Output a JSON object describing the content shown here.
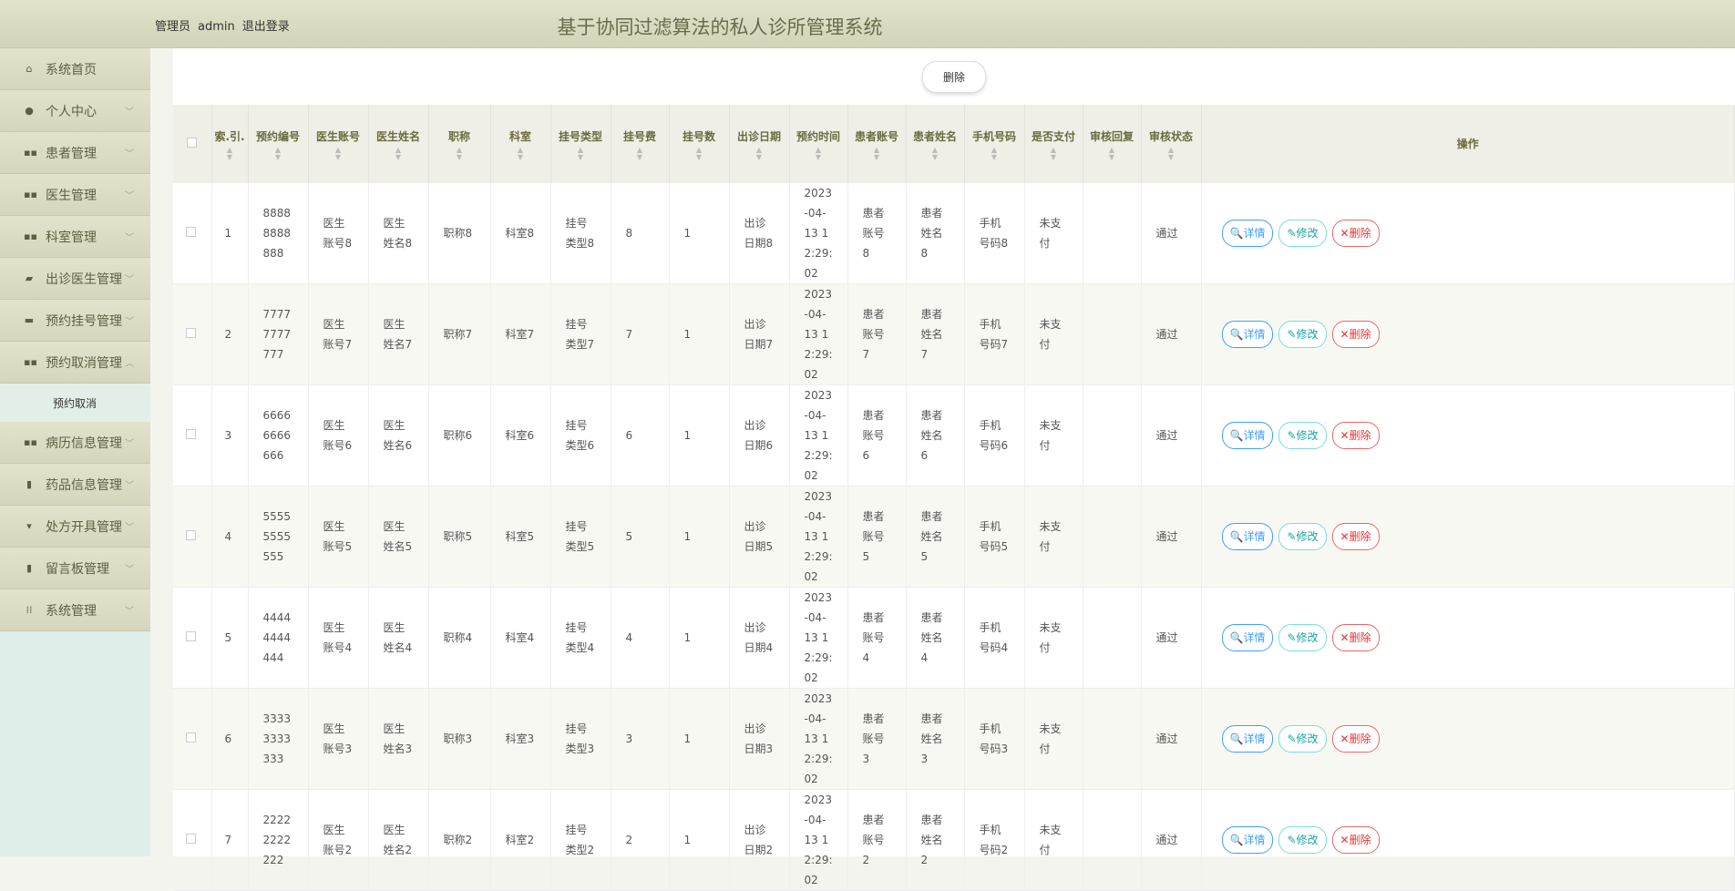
{
  "header": {
    "role": "管理员",
    "user": "admin",
    "logout": "退出登录",
    "title": "基于协同过滤算法的私人诊所管理系统"
  },
  "sidebar": {
    "items": [
      {
        "label": "系统首页",
        "icon": "home-icon"
      },
      {
        "label": "个人中心",
        "icon": "user-icon"
      },
      {
        "label": "患者管理",
        "icon": "grid-icon"
      },
      {
        "label": "医生管理",
        "icon": "grid-icon"
      },
      {
        "label": "科室管理",
        "icon": "grid-icon"
      },
      {
        "label": "出诊医生管理",
        "icon": "briefcase-icon"
      },
      {
        "label": "预约挂号管理",
        "icon": "monitor-icon"
      },
      {
        "label": "预约取消管理",
        "icon": "grid-icon",
        "sub": "预约取消"
      },
      {
        "label": "病历信息管理",
        "icon": "grid-icon"
      },
      {
        "label": "药品信息管理",
        "icon": "clipboard-icon"
      },
      {
        "label": "处方开具管理",
        "icon": "stamp-icon"
      },
      {
        "label": "留言板管理",
        "icon": "clipboard-x-icon"
      },
      {
        "label": "系统管理",
        "icon": "apps-icon"
      }
    ]
  },
  "toolbar": {
    "delete": "删除"
  },
  "table": {
    "headers": [
      "索.引.",
      "预约编号",
      "医生账号",
      "医生姓名",
      "职称",
      "科室",
      "挂号类型",
      "挂号费",
      "挂号数",
      "出诊日期",
      "预约时间",
      "患者账号",
      "患者姓名",
      "手机号码",
      "是否支付",
      "审核回复",
      "审核状态",
      "操作"
    ],
    "actions": {
      "detail": "详情",
      "edit": "修改",
      "delete": "删除"
    },
    "rows": [
      [
        "1",
        "88888888888",
        "医生账号8",
        "医生姓名8",
        "职称8",
        "科室8",
        "挂号类型8",
        "8",
        "1",
        "出诊日期8",
        "2023-04-13 12:29:02",
        "患者账号8",
        "患者姓名8",
        "手机号码8",
        "未支付",
        "",
        "通过"
      ],
      [
        "2",
        "77777777777",
        "医生账号7",
        "医生姓名7",
        "职称7",
        "科室7",
        "挂号类型7",
        "7",
        "1",
        "出诊日期7",
        "2023-04-13 12:29:02",
        "患者账号7",
        "患者姓名7",
        "手机号码7",
        "未支付",
        "",
        "通过"
      ],
      [
        "3",
        "66666666666",
        "医生账号6",
        "医生姓名6",
        "职称6",
        "科室6",
        "挂号类型6",
        "6",
        "1",
        "出诊日期6",
        "2023-04-13 12:29:02",
        "患者账号6",
        "患者姓名6",
        "手机号码6",
        "未支付",
        "",
        "通过"
      ],
      [
        "4",
        "55555555555",
        "医生账号5",
        "医生姓名5",
        "职称5",
        "科室5",
        "挂号类型5",
        "5",
        "1",
        "出诊日期5",
        "2023-04-13 12:29:02",
        "患者账号5",
        "患者姓名5",
        "手机号码5",
        "未支付",
        "",
        "通过"
      ],
      [
        "5",
        "44444444444",
        "医生账号4",
        "医生姓名4",
        "职称4",
        "科室4",
        "挂号类型4",
        "4",
        "1",
        "出诊日期4",
        "2023-04-13 12:29:02",
        "患者账号4",
        "患者姓名4",
        "手机号码4",
        "未支付",
        "",
        "通过"
      ],
      [
        "6",
        "33333333333",
        "医生账号3",
        "医生姓名3",
        "职称3",
        "科室3",
        "挂号类型3",
        "3",
        "1",
        "出诊日期3",
        "2023-04-13 12:29:02",
        "患者账号3",
        "患者姓名3",
        "手机号码3",
        "未支付",
        "",
        "通过"
      ],
      [
        "7",
        "22222222222",
        "医生账号2",
        "医生姓名2",
        "职称2",
        "科室2",
        "挂号类型2",
        "2",
        "1",
        "出诊日期2",
        "2023-04-13 12:29:02",
        "患者账号2",
        "患者姓名2",
        "手机号码2",
        "未支付",
        "",
        "通过"
      ]
    ]
  }
}
